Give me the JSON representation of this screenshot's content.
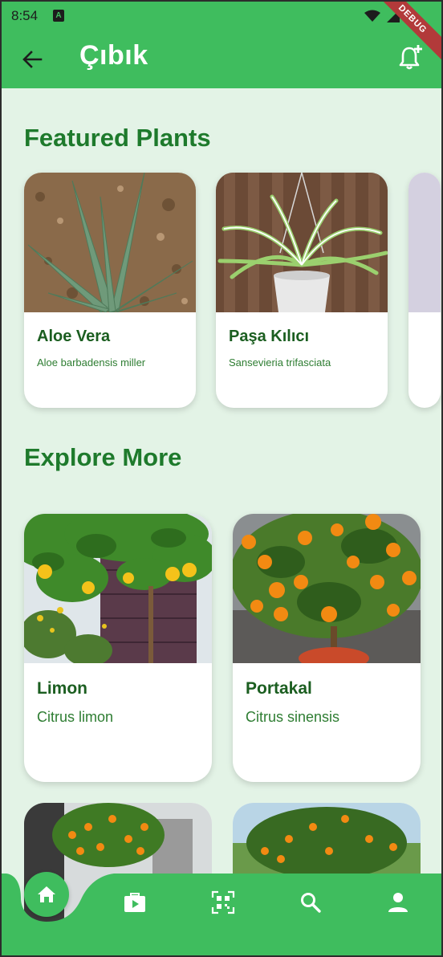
{
  "status_bar": {
    "time": "8:54",
    "notification_badge": "A"
  },
  "app_bar": {
    "title": "Çıbık",
    "debug_ribbon": "DEBUG"
  },
  "featured": {
    "title": "Featured Plants",
    "items": [
      {
        "name": "Aloe Vera",
        "scientific": "Aloe barbadensis miller"
      },
      {
        "name": "Paşa Kılıcı",
        "scientific": "Sansevieria trifasciata"
      }
    ]
  },
  "explore": {
    "title": "Explore More",
    "items": [
      {
        "name": "Limon",
        "scientific": "Citrus limon"
      },
      {
        "name": "Portakal",
        "scientific": "Citrus sinensis"
      }
    ]
  },
  "bottom_nav": {
    "items": [
      "home-icon",
      "video-library-icon",
      "qr-code-icon",
      "search-icon",
      "person-icon"
    ],
    "active": "home-icon"
  },
  "colors": {
    "primary": "#3fbd5e",
    "background": "#e3f3e6",
    "title_green": "#1e7a2c"
  }
}
